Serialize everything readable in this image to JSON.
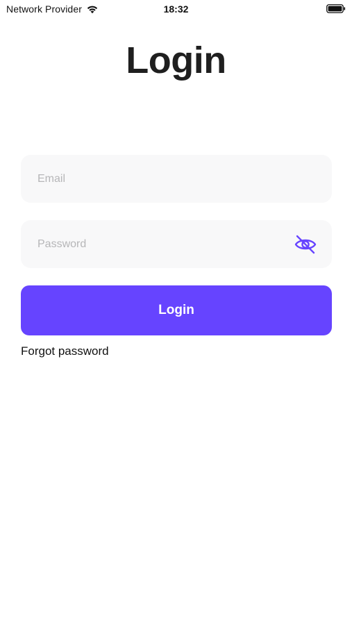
{
  "status_bar": {
    "carrier": "Network Provider",
    "time": "18:32",
    "wifi_icon": "wifi-icon",
    "battery_icon": "battery-icon"
  },
  "title": "Login",
  "email_field": {
    "placeholder": "Email",
    "value": ""
  },
  "password_field": {
    "placeholder": "Password",
    "value": "",
    "toggle_icon": "eye-off-icon"
  },
  "login_button": {
    "label": "Login"
  },
  "forgot_password": {
    "label": "Forgot password"
  },
  "colors": {
    "accent": "#6644ff",
    "field_background": "#f8f8f9",
    "placeholder": "#b6b6b8",
    "title": "#1f1f1f"
  }
}
